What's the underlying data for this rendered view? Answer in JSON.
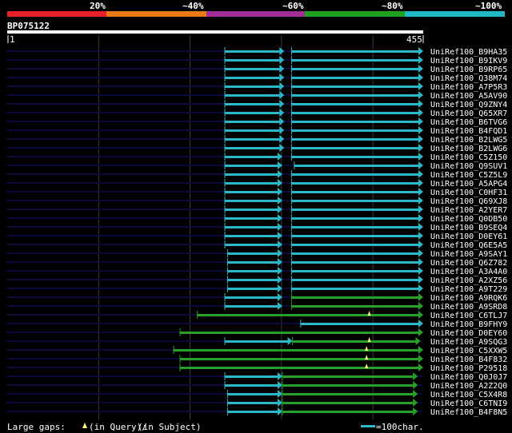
{
  "identity_scale": {
    "labels": [
      "20%",
      "~40%",
      "~60%",
      "~80%",
      "~100%"
    ],
    "colors": [
      "#e8202a",
      "#e87a18",
      "#a02e96",
      "#1fa01f",
      "#1fb8c4"
    ]
  },
  "query": {
    "id": "BP075122",
    "start_label": "1",
    "end_label": "455",
    "length": 455
  },
  "colors": {
    "background": "#000000",
    "query_line": "#0a0a3c",
    "grid": "#3a3a3a",
    "cyan": "#2ab8c8",
    "green": "#26a026",
    "insertion_marker": "#ffff80"
  },
  "hits": [
    {
      "name": "UniRef100_B9HA35",
      "segs": [
        [
          238,
          303,
          "c"
        ],
        [
          311,
          455,
          "c"
        ]
      ]
    },
    {
      "name": "UniRef100_B9IKV9",
      "segs": [
        [
          238,
          303,
          "c"
        ],
        [
          311,
          455,
          "c"
        ]
      ]
    },
    {
      "name": "UniRef100_B9RP65",
      "segs": [
        [
          238,
          303,
          "c"
        ],
        [
          311,
          455,
          "c"
        ]
      ]
    },
    {
      "name": "UniRef100_Q38M74",
      "segs": [
        [
          238,
          303,
          "c"
        ],
        [
          311,
          455,
          "c"
        ]
      ]
    },
    {
      "name": "UniRef100_A7P5R3",
      "segs": [
        [
          238,
          303,
          "c"
        ],
        [
          311,
          455,
          "c"
        ]
      ]
    },
    {
      "name": "UniRef100_A5AV90",
      "segs": [
        [
          238,
          303,
          "c"
        ],
        [
          311,
          455,
          "c"
        ]
      ]
    },
    {
      "name": "UniRef100_Q9ZNY4",
      "segs": [
        [
          238,
          303,
          "c"
        ],
        [
          311,
          455,
          "c"
        ]
      ]
    },
    {
      "name": "UniRef100_Q65XR7",
      "segs": [
        [
          238,
          303,
          "c"
        ],
        [
          311,
          455,
          "c"
        ]
      ]
    },
    {
      "name": "UniRef100_B6TVG6",
      "segs": [
        [
          238,
          303,
          "c"
        ],
        [
          311,
          455,
          "c"
        ]
      ]
    },
    {
      "name": "UniRef100_B4FQD1",
      "segs": [
        [
          238,
          303,
          "c"
        ],
        [
          311,
          455,
          "c"
        ]
      ]
    },
    {
      "name": "UniRef100_B2LWG5",
      "segs": [
        [
          238,
          303,
          "c"
        ],
        [
          311,
          455,
          "c"
        ]
      ]
    },
    {
      "name": "UniRef100_B2LWG6",
      "segs": [
        [
          238,
          303,
          "c"
        ],
        [
          311,
          455,
          "c"
        ]
      ]
    },
    {
      "name": "UniRef100_C5Z150",
      "segs": [
        [
          238,
          301,
          "c"
        ],
        [
          311,
          455,
          "c"
        ]
      ]
    },
    {
      "name": "UniRef100_Q9SUV1",
      "segs": [
        [
          238,
          301,
          "c"
        ],
        [
          314,
          455,
          "c"
        ]
      ]
    },
    {
      "name": "UniRef100_C5Z5L9",
      "segs": [
        [
          238,
          301,
          "c"
        ],
        [
          311,
          455,
          "c"
        ]
      ]
    },
    {
      "name": "UniRef100_A5APG4",
      "segs": [
        [
          238,
          301,
          "c"
        ],
        [
          311,
          455,
          "c"
        ]
      ]
    },
    {
      "name": "UniRef100_C0HF31",
      "segs": [
        [
          238,
          301,
          "c"
        ],
        [
          311,
          455,
          "c"
        ]
      ]
    },
    {
      "name": "UniRef100_Q69XJ8",
      "segs": [
        [
          238,
          301,
          "c"
        ],
        [
          311,
          455,
          "c"
        ]
      ]
    },
    {
      "name": "UniRef100_A2YER7",
      "segs": [
        [
          238,
          301,
          "c"
        ],
        [
          311,
          455,
          "c"
        ]
      ]
    },
    {
      "name": "UniRef100_Q0DB50",
      "segs": [
        [
          238,
          301,
          "c"
        ],
        [
          311,
          455,
          "c"
        ]
      ]
    },
    {
      "name": "UniRef100_B9SEQ4",
      "segs": [
        [
          238,
          301,
          "c"
        ],
        [
          311,
          455,
          "c"
        ]
      ]
    },
    {
      "name": "UniRef100_D0EY61",
      "segs": [
        [
          238,
          301,
          "c"
        ],
        [
          311,
          455,
          "c"
        ]
      ]
    },
    {
      "name": "UniRef100_Q6E5A5",
      "segs": [
        [
          238,
          301,
          "c"
        ],
        [
          311,
          455,
          "c"
        ]
      ]
    },
    {
      "name": "UniRef100_A9SAY1",
      "segs": [
        [
          241,
          301,
          "c"
        ],
        [
          311,
          455,
          "c"
        ]
      ]
    },
    {
      "name": "UniRef100_Q6Z782",
      "segs": [
        [
          241,
          301,
          "c"
        ],
        [
          311,
          455,
          "c"
        ]
      ]
    },
    {
      "name": "UniRef100_A3A4A0",
      "segs": [
        [
          241,
          301,
          "c"
        ],
        [
          311,
          455,
          "c"
        ]
      ]
    },
    {
      "name": "UniRef100_A2XZ56",
      "segs": [
        [
          241,
          301,
          "c"
        ],
        [
          311,
          455,
          "c"
        ]
      ]
    },
    {
      "name": "UniRef100_A9T229",
      "segs": [
        [
          241,
          301,
          "c"
        ],
        [
          311,
          455,
          "c"
        ]
      ]
    },
    {
      "name": "UniRef100_A9RQK6",
      "segs": [
        [
          238,
          301,
          "c"
        ],
        [
          311,
          455,
          "g"
        ]
      ]
    },
    {
      "name": "UniRef100_A9SRD8",
      "segs": [
        [
          238,
          301,
          "c"
        ],
        [
          311,
          455,
          "g"
        ]
      ]
    },
    {
      "name": "UniRef100_C6TLJ7",
      "segs": [
        [
          208,
          455,
          "g"
        ]
      ],
      "gap": [
        396
      ]
    },
    {
      "name": "UniRef100_B9FHY9",
      "segs": [
        [
          321,
          455,
          "c"
        ]
      ]
    },
    {
      "name": "UniRef100_D0EY60",
      "segs": [
        [
          189,
          455,
          "g"
        ]
      ]
    },
    {
      "name": "UniRef100_A9SQG3",
      "segs": [
        [
          238,
          312,
          "c"
        ],
        [
          312,
          452,
          "g"
        ]
      ],
      "gap": [
        396
      ]
    },
    {
      "name": "UniRef100_C5XXW5",
      "segs": [
        [
          182,
          455,
          "g"
        ]
      ],
      "gap": [
        393
      ]
    },
    {
      "name": "UniRef100_B4F832",
      "segs": [
        [
          189,
          455,
          "g"
        ]
      ],
      "gap": [
        393
      ]
    },
    {
      "name": "UniRef100_P29518",
      "segs": [
        [
          189,
          455,
          "g"
        ]
      ],
      "gap": [
        393
      ]
    },
    {
      "name": "UniRef100_Q0J0J7",
      "segs": [
        [
          238,
          301,
          "c"
        ],
        [
          301,
          449,
          "g"
        ]
      ]
    },
    {
      "name": "UniRef100_A2Z2Q0",
      "segs": [
        [
          238,
          301,
          "c"
        ],
        [
          301,
          449,
          "g"
        ]
      ]
    },
    {
      "name": "UniRef100_C5X4R8",
      "segs": [
        [
          241,
          301,
          "c"
        ],
        [
          301,
          449,
          "g"
        ]
      ]
    },
    {
      "name": "UniRef100_C6TNI9",
      "segs": [
        [
          241,
          301,
          "c"
        ],
        [
          301,
          449,
          "g"
        ]
      ]
    },
    {
      "name": "UniRef100_B4F8N5",
      "segs": [
        [
          241,
          301,
          "c"
        ],
        [
          301,
          449,
          "g"
        ]
      ]
    }
  ],
  "legend": {
    "gap_text_prefix": "Large gaps: ",
    "gap_text_query": "(in Query)/",
    "gap_text_subject": "(in Subject)",
    "scale_text": "=100char."
  }
}
